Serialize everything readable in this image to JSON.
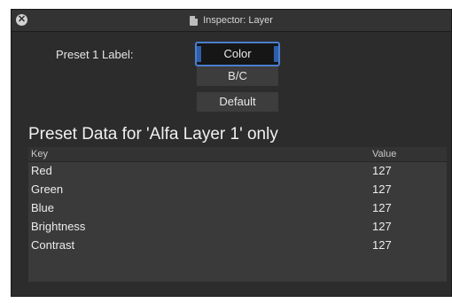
{
  "window": {
    "title": "Inspector: Layer",
    "close_icon": "close-x-icon",
    "doc_icon": "document-icon"
  },
  "preset": {
    "label": "Preset 1 Label:",
    "options": [
      "Color",
      "B/C",
      "Default"
    ],
    "selected": "Color"
  },
  "heading": "Preset Data for 'Alfa Layer 1' only",
  "table": {
    "columns": {
      "key": "Key",
      "value": "Value"
    },
    "rows": [
      {
        "key": "Red",
        "value": "127"
      },
      {
        "key": "Green",
        "value": "127"
      },
      {
        "key": "Blue",
        "value": "127"
      },
      {
        "key": "Brightness",
        "value": "127"
      },
      {
        "key": "Contrast",
        "value": "127"
      }
    ]
  },
  "colors": {
    "window_bg": "#2c2c2c",
    "accent": "#4a7fcf",
    "table_bg": "#3a3a3a"
  }
}
